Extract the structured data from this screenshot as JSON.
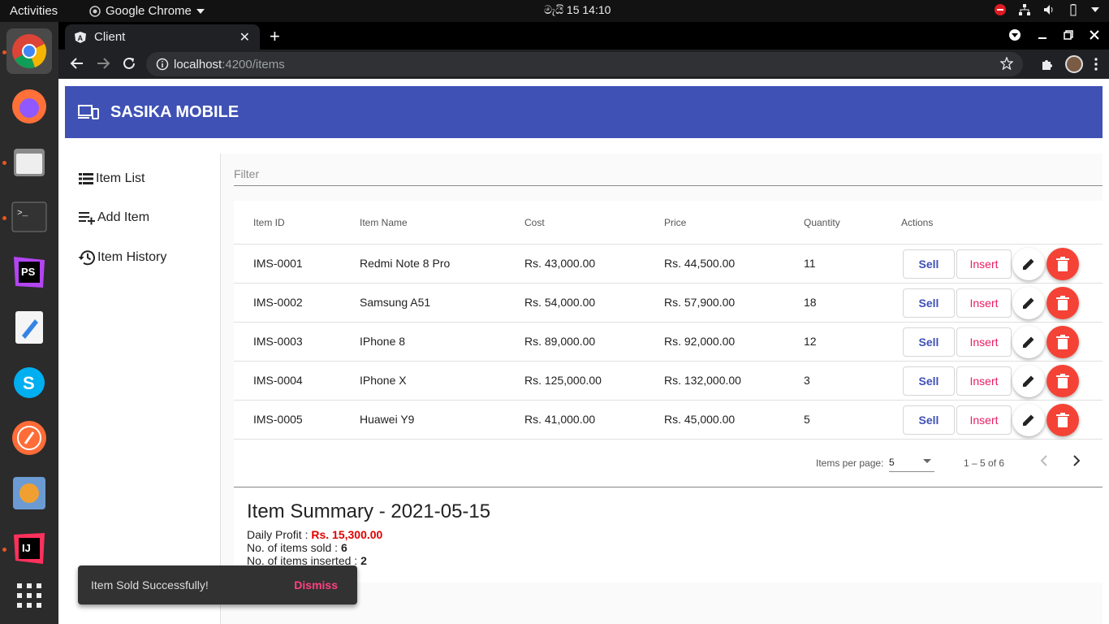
{
  "system": {
    "activities_label": "Activities",
    "app_menu_label": "Google Chrome",
    "clock": "මැයි  15  14:10"
  },
  "browser": {
    "tab_title": "Client",
    "url_host": "localhost",
    "url_path": ":4200/items"
  },
  "app": {
    "brand": "SASIKA MOBILE",
    "nav": [
      {
        "label": "Item List",
        "icon": "list-icon"
      },
      {
        "label": "Add Item",
        "icon": "playlist-add-icon"
      },
      {
        "label": "Item History",
        "icon": "history-icon"
      }
    ],
    "filter_placeholder": "Filter",
    "table": {
      "headers": [
        "Item ID",
        "Item Name",
        "Cost",
        "Price",
        "Quantity",
        "Actions"
      ],
      "rows": [
        {
          "id": "IMS-0001",
          "name": "Redmi Note 8 Pro",
          "cost": "Rs. 43,000.00",
          "price": "Rs. 44,500.00",
          "qty": "11"
        },
        {
          "id": "IMS-0002",
          "name": "Samsung A51",
          "cost": "Rs. 54,000.00",
          "price": "Rs. 57,900.00",
          "qty": "18"
        },
        {
          "id": "IMS-0003",
          "name": "IPhone 8",
          "cost": "Rs. 89,000.00",
          "price": "Rs. 92,000.00",
          "qty": "12"
        },
        {
          "id": "IMS-0004",
          "name": "IPhone X",
          "cost": "Rs. 125,000.00",
          "price": "Rs. 132,000.00",
          "qty": "3"
        },
        {
          "id": "IMS-0005",
          "name": "Huawei Y9",
          "cost": "Rs. 41,000.00",
          "price": "Rs. 45,000.00",
          "qty": "5"
        }
      ],
      "sell_label": "Sell",
      "insert_label": "Insert"
    },
    "paginator": {
      "items_per_page_label": "Items per page:",
      "page_size": "5",
      "range": "1 – 5 of 6"
    },
    "summary": {
      "title": "Item Summary - 2021-05-15",
      "profit_label": "Daily Profit : ",
      "profit_value": "Rs. 15,300.00",
      "sold_label": "No. of items sold : ",
      "sold_value": "6",
      "inserted_label": "No. of items inserted : ",
      "inserted_value": "2"
    },
    "snackbar": {
      "message": "Item Sold Successfully!",
      "action": "Dismiss"
    },
    "colors": {
      "primary": "#3f51b5",
      "accent": "#e91e63",
      "warn": "#f44336",
      "profit": "#e00000"
    }
  }
}
